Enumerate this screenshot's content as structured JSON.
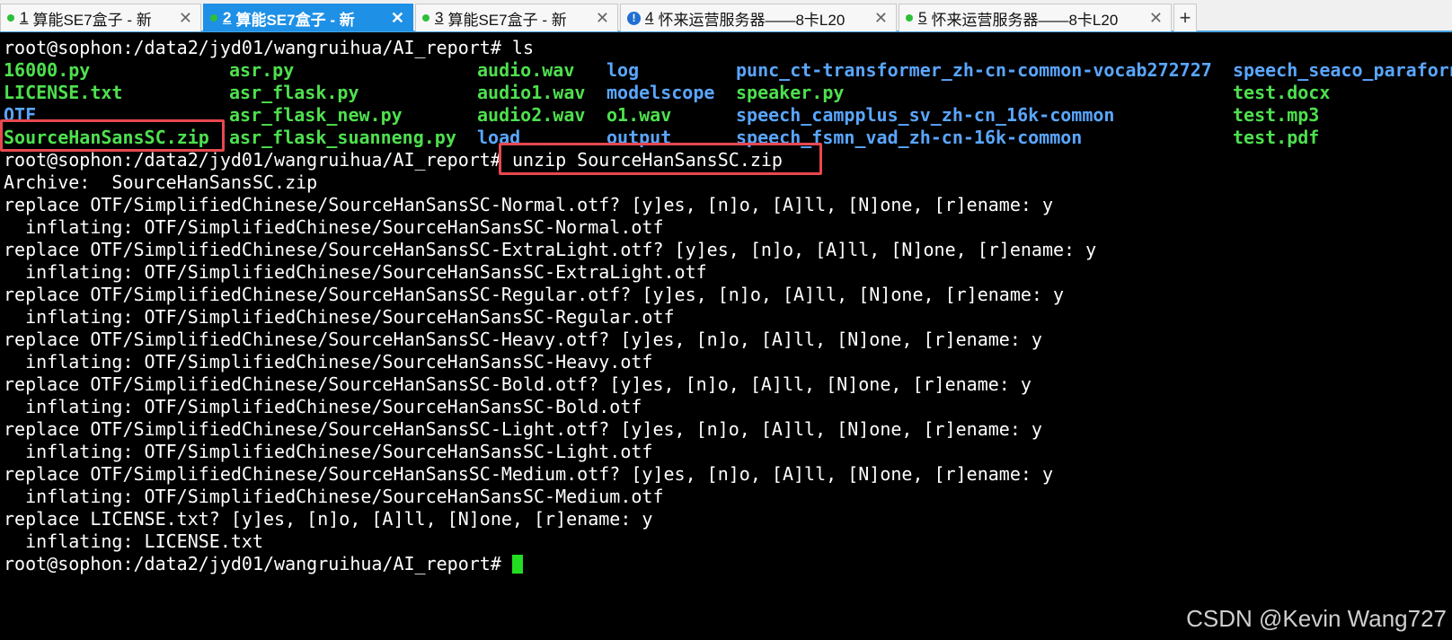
{
  "tabs": [
    {
      "num": "1",
      "label": "算能SE7盒子 - 新",
      "status": "dot",
      "active": false
    },
    {
      "num": "2",
      "label": "算能SE7盒子 - 新",
      "status": "dot",
      "active": true
    },
    {
      "num": "3",
      "label": "算能SE7盒子 - 新",
      "status": "dot",
      "active": false
    },
    {
      "num": "4",
      "label": "怀来运营服务器——8卡L20",
      "status": "warn",
      "active": false
    },
    {
      "num": "5",
      "label": "怀来运营服务器——8卡L20",
      "status": "dot",
      "active": false
    }
  ],
  "tab_close_glyph": "✕",
  "new_tab_glyph": "+",
  "warn_glyph": "!",
  "colors": {
    "accent": "#1e90e6",
    "exec": "#4ee04e",
    "dir": "#5aa6ff",
    "highlight": "#e8484f"
  },
  "terminal": {
    "cmd1": "root@sophon:/data2/jyd01/wangruihua/AI_report# ls",
    "ls": {
      "col1": [
        "16000.py",
        "LICENSE.txt",
        "OTF",
        "SourceHanSansSC.zip"
      ],
      "col2": [
        "asr.py",
        "asr_flask.py",
        "asr_flask_new.py",
        "asr_flask_suanneng.py"
      ],
      "col3": [
        "audio.wav",
        "audio1.wav",
        "audio2.wav",
        "load"
      ],
      "col4": [
        "log",
        "modelscope",
        "o1.wav",
        "output"
      ],
      "col5": [
        "punc_ct-transformer_zh-cn-common-vocab272727",
        "speaker.py",
        "speech_campplus_sv_zh-cn_16k-common",
        "speech_fsmn_vad_zh-cn-16k-common"
      ],
      "col6": [
        "speech_seaco_paraforn",
        "test.docx",
        "test.mp3",
        "test.pdf"
      ]
    },
    "prompt": "root@sophon:/data2/jyd01/wangruihua/AI_report# ",
    "cmd2": "unzip SourceHanSansSC.zip",
    "output": [
      "Archive:  SourceHanSansSC.zip",
      "replace OTF/SimplifiedChinese/SourceHanSansSC-Normal.otf? [y]es, [n]o, [A]ll, [N]one, [r]ename: y",
      "  inflating: OTF/SimplifiedChinese/SourceHanSansSC-Normal.otf",
      "replace OTF/SimplifiedChinese/SourceHanSansSC-ExtraLight.otf? [y]es, [n]o, [A]ll, [N]one, [r]ename: y",
      "  inflating: OTF/SimplifiedChinese/SourceHanSansSC-ExtraLight.otf",
      "replace OTF/SimplifiedChinese/SourceHanSansSC-Regular.otf? [y]es, [n]o, [A]ll, [N]one, [r]ename: y",
      "  inflating: OTF/SimplifiedChinese/SourceHanSansSC-Regular.otf",
      "replace OTF/SimplifiedChinese/SourceHanSansSC-Heavy.otf? [y]es, [n]o, [A]ll, [N]one, [r]ename: y",
      "  inflating: OTF/SimplifiedChinese/SourceHanSansSC-Heavy.otf",
      "replace OTF/SimplifiedChinese/SourceHanSansSC-Bold.otf? [y]es, [n]o, [A]ll, [N]one, [r]ename: y",
      "  inflating: OTF/SimplifiedChinese/SourceHanSansSC-Bold.otf",
      "replace OTF/SimplifiedChinese/SourceHanSansSC-Light.otf? [y]es, [n]o, [A]ll, [N]one, [r]ename: y",
      "  inflating: OTF/SimplifiedChinese/SourceHanSansSC-Light.otf",
      "replace OTF/SimplifiedChinese/SourceHanSansSC-Medium.otf? [y]es, [n]o, [A]ll, [N]one, [r]ename: y",
      "  inflating: OTF/SimplifiedChinese/SourceHanSansSC-Medium.otf",
      "replace LICENSE.txt? [y]es, [n]o, [A]ll, [N]one, [r]ename: y",
      "  inflating: LICENSE.txt"
    ]
  },
  "watermark": "CSDN @Kevin Wang727"
}
